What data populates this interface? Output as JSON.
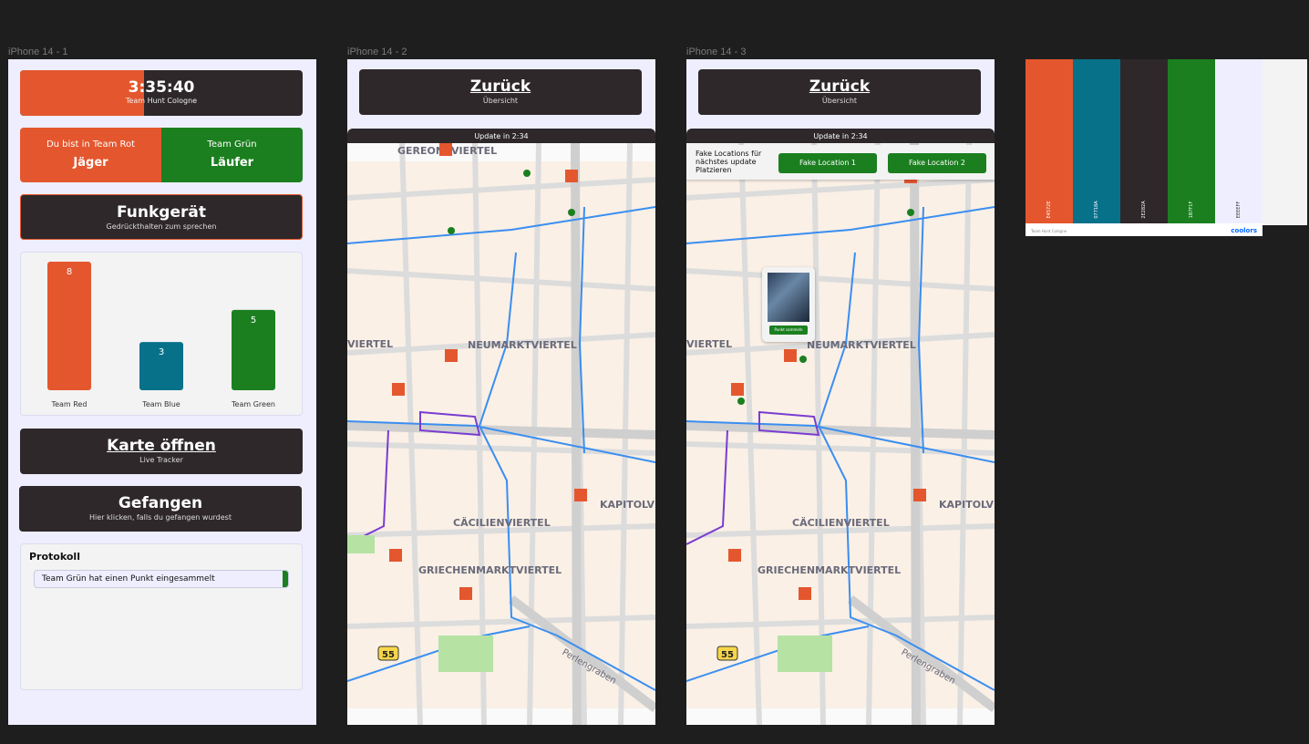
{
  "frames": {
    "f1": "iPhone 14 - 1",
    "f2": "iPhone 14 - 2",
    "f3": "iPhone 14 - 3"
  },
  "home": {
    "timer": "3:35:40",
    "timer_progress": 0.44,
    "team_name": "Team Hunt Cologne",
    "team_left_label": "Du bist in Team Rot",
    "team_left_role": "Jäger",
    "team_right_label": "Team Grün",
    "team_right_role": "Läufer",
    "radio_title": "Funkgerät",
    "radio_sub": "Gedrückthalten zum sprechen",
    "map_title": "Karte öffnen",
    "map_sub": "Live Tracker",
    "caught_title": "Gefangen",
    "caught_sub": "Hier klicken, falls du gefangen wurdest",
    "log_title": "Protokoll",
    "log_items": [
      "Team Grün hat einen Punkt eingesammelt"
    ]
  },
  "chart_data": {
    "type": "bar",
    "categories": [
      "Team Red",
      "Team Blue",
      "Team Green"
    ],
    "values": [
      8,
      3,
      5
    ],
    "colors": [
      "#e4572e",
      "#07718a",
      "#1b7f1f"
    ],
    "ylim": [
      0,
      8
    ]
  },
  "map_screen": {
    "back_title": "Zurück",
    "back_sub": "Übersicht",
    "update": "Update in 2:34",
    "fake_text": "Fake Locations für nächstes update Platzieren",
    "fake1": "Fake Location 1",
    "fake2": "Fake Location 2",
    "popup_btn": "Punkt sammeln",
    "districts": [
      "GEREONSVIERTEL",
      "NEUMARKTVIERTEL",
      "VIERTEL",
      "KAPITOLVI",
      "CÄCILIENVIERTEL",
      "GRIECHENMARKTVIERTEL",
      "Perlengraben",
      "55"
    ]
  },
  "palette": {
    "colors": [
      "#e4572e",
      "#07718a",
      "#2e282a",
      "#1b7f1f",
      "#eeeeff",
      "#f3f3f3"
    ],
    "codes": [
      "E4572E",
      "07718A",
      "2E282A",
      "1B7F1F",
      "EEEEFF"
    ],
    "footer": "Team Hunt Cologne",
    "brand": "coolors"
  }
}
